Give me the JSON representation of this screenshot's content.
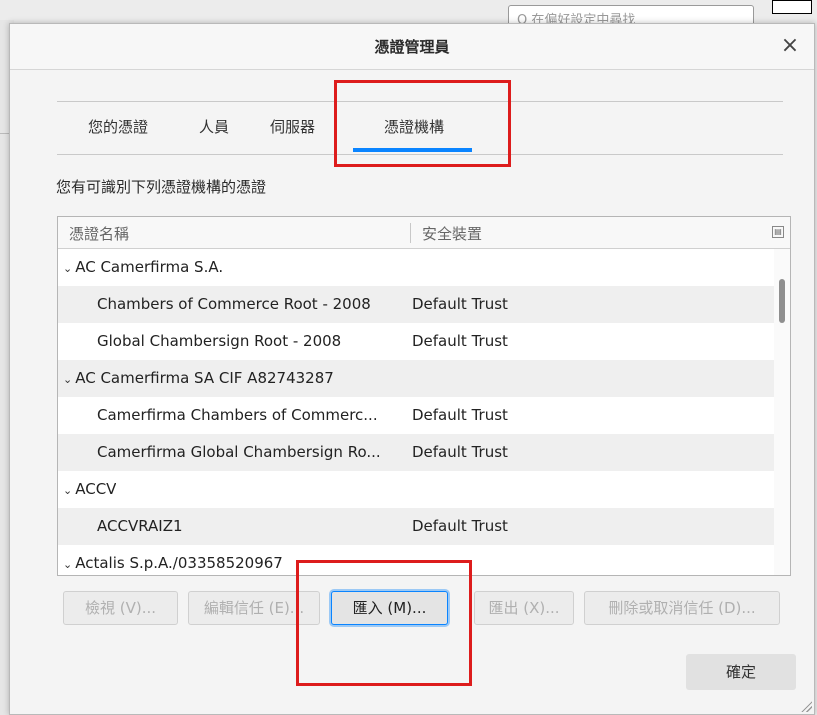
{
  "background": {
    "search_placeholder": "Q 在偏好設定中尋找"
  },
  "dialog": {
    "title": "憑證管理員",
    "close_glyph": "×",
    "tabs": [
      {
        "label": "您的憑證"
      },
      {
        "label": "人員"
      },
      {
        "label": "伺服器"
      },
      {
        "label": "憑證機構",
        "active": true
      }
    ],
    "description": "您有可識別下列憑證機構的憑證",
    "columns": {
      "name": "憑證名稱",
      "device": "安全裝置"
    },
    "rows": [
      {
        "type": "group",
        "name": "AC Camerfirma S.A.",
        "device": ""
      },
      {
        "type": "leaf",
        "name": "Chambers of Commerce Root - 2008",
        "device": "Default Trust"
      },
      {
        "type": "leaf",
        "name": "Global Chambersign Root - 2008",
        "device": "Default Trust"
      },
      {
        "type": "group",
        "name": "AC Camerfirma SA CIF A82743287",
        "device": ""
      },
      {
        "type": "leaf",
        "name": "Camerfirma Chambers of Commerc...",
        "device": "Default Trust"
      },
      {
        "type": "leaf",
        "name": "Camerfirma Global Chambersign Ro...",
        "device": "Default Trust"
      },
      {
        "type": "group",
        "name": "ACCV",
        "device": ""
      },
      {
        "type": "leaf",
        "name": "ACCVRAIZ1",
        "device": "Default Trust"
      },
      {
        "type": "group",
        "name": "Actalis S.p.A./03358520967",
        "device": ""
      }
    ],
    "buttons": {
      "view": "檢視 (V)...",
      "edit_trust": "編輯信任 (E)...",
      "import": "匯入 (M)...",
      "export": "匯出 (X)...",
      "delete": "刪除或取消信任 (D)...",
      "ok": "確定"
    }
  },
  "colors": {
    "accent": "#0a84ff",
    "highlight": "#dd1c1c"
  }
}
